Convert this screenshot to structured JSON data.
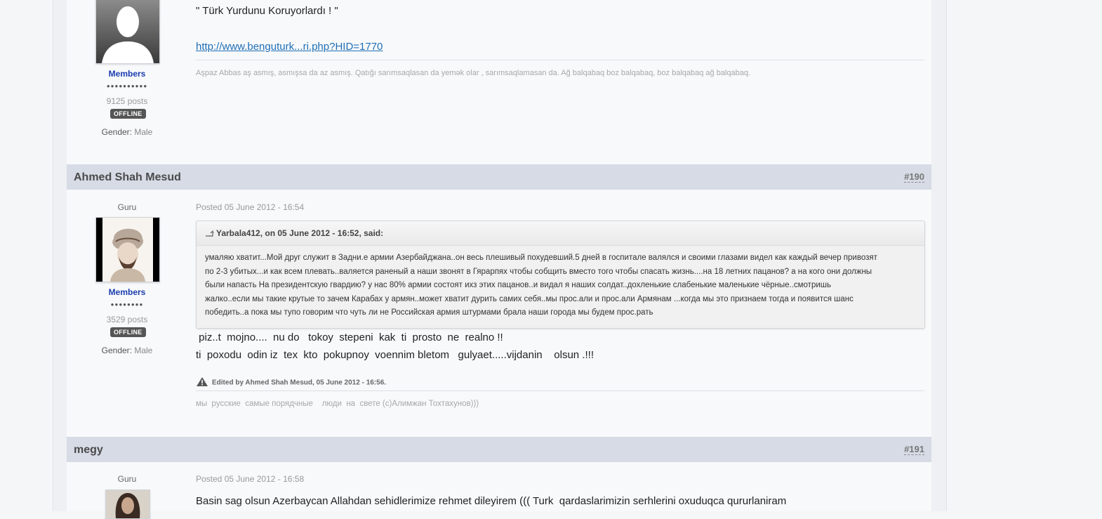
{
  "post_prev": {
    "quote_line": "\" Türk Yurdunu Koruyorlardı ! \"",
    "link": "http://www.benguturk...ri.php?HID=1770",
    "signature": "Aşpaz Abbas aş asmış, asmışsa da az asmış. Qatığı sarımsaqlasan da yemək olar , sarımsaqlamasan da. Ağ balqabaq boz balqabaq, boz balqabaq ağ balqabaq.",
    "group": "Members",
    "pips": "●●●●●●●●●●",
    "posts": "9125 posts",
    "status": "OFFLINE",
    "gender_label": "Gender:",
    "gender_value": "Male",
    "avatar_icon": "default-user-silhouette-icon"
  },
  "post_190": {
    "author": "Ahmed Shah Mesud",
    "number": "#190",
    "rank": "Guru",
    "group": "Members",
    "pips": "●●●●●●●●",
    "posts": "3529 posts",
    "status": "OFFLINE",
    "gender_label": "Gender:",
    "gender_value": "Male",
    "posted": "Posted 05 June 2012 - 16:54",
    "quote_header": "Yarbala412, on 05 June 2012 - 16:52, said:",
    "quote_lines": [
      "умаляю хватит...Мой друг служит в Задни.е армии Азербайджана..он весь плешивый похудевший.5 дней в госпитале валялся и своими глазами видел как каждый вечер привозят",
      "по 2-3 убитых...и как всем плевать..валяется раненый а наши звонят в Гярарпях чтобы собщить вместо того чтобы спасать жизнь....на 18 летних пацанов? а на кого они должны",
      "были напасть На президентскую гвардию? у нас 80% армии состоят ихз этих пацанов..и видал я наших солдат..дохленькие слабенькие маленькие чёрные..смотришь",
      "жалко..если мы такие крутые то зачем Карабах у армян..может хватит дурить самих себя..мы прос.али и прос.али Армянам ...когда мы это признаем тогда и появится шанс",
      "победить..а пока мы тупо говорим что чуть ли не Российская армия штурмами брала наши города мы будем прос.рать"
    ],
    "body_line1": " piz..t  mojno....  nu do   tokoy  stepeni  kak  ti  prosto  ne  realno !!",
    "body_line2": "ti  poxodu  odin iz  tex  kto  pokupnoy  voennim bletom   gulyaet.....vijdanin    olsun .!!!",
    "edited": "Edited by Ahmed Shah Mesud, 05 June 2012 - 16:56.",
    "signature": "мы  русские  самые порядчные    люди  на  свете (с)Алимжан Тохтахунов)))"
  },
  "post_191": {
    "author": "megy",
    "number": "#191",
    "rank": "Guru",
    "posted": "Posted 05 June 2012 - 16:58",
    "body": "Basin sag olsun Azerbaycan Allahdan sehidlerimize rehmet dileyirem ((( Turk  qardaslarimizin serhlerini oxuduqca qururlaniram"
  }
}
